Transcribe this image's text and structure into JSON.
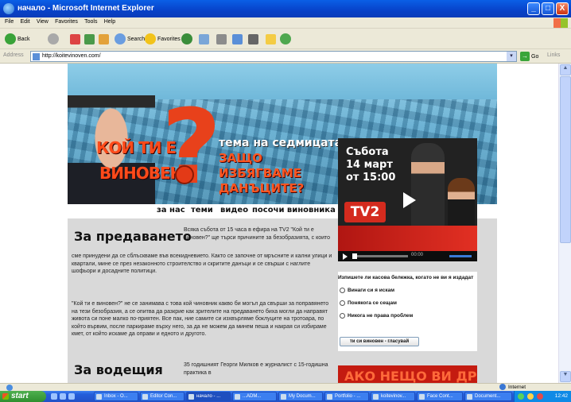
{
  "window": {
    "title": "начало - Microsoft Internet Explorer",
    "buttons": [
      "_",
      "□",
      "X"
    ]
  },
  "menu": [
    "File",
    "Edit",
    "View",
    "Favorites",
    "Tools",
    "Help"
  ],
  "toolbar": {
    "back": "Back",
    "search": "Search",
    "favorites": "Favorites"
  },
  "address": {
    "label": "Address",
    "url": "http://koitevinoven.com/",
    "go": "Go",
    "links": "Links"
  },
  "hero": {
    "headline_1": "КОЙ ТИ Е",
    "headline_2": "ВИНОВЕН",
    "qmark": "?",
    "topic_label": "тема на седмицата:",
    "topic_text": "ЗАЩО ИЗБЯГВАМЕ ДАНЪЦИТЕ?"
  },
  "nav": [
    "за нас",
    "теми",
    "видео",
    "посочи виновника"
  ],
  "promo": {
    "line1": "Събота",
    "line2": "14 март",
    "line3": "от 15:00",
    "channel": "TV2",
    "time": "00:00"
  },
  "poll": {
    "question": "Изпишете ли касова бележка, когато не ви я издадат",
    "options": [
      "Винаги си я искам",
      "Понякога се сещам",
      "Никога не права проблем"
    ],
    "vote": "ти си виновен - гласувай"
  },
  "ad": "АКО НЕЩО ВИ ДРАЗНИ",
  "articles": [
    {
      "title": "За предаването",
      "intro": "Всяка събота от 15 часа в ефира на TV2 \"Кой ти е виновен?\" ще търси причините за безобразията, с които",
      "p1": "сме принудени да се сблъскваме във всекидневието. Както се започне от мръсните и кални улици и квартали, мине се през незаконното строителство и скритите данъци и се свърши с наглите шофьори и досадните политици.",
      "p2": "\"Кой ти е виновен?\" не се занимава с това кой чиновник какво би могъл да свърши за поправянето на тези безобразия, а се опитва да разкрие как зрителите на предаването биха могли да направят живота си поне малко по-приятен. Все пак, ние самите си изхвърляме боклуците на тротоара, по който вървим, после паркираме върху него, за да не можем да минем пеша и накрая си избираме кмет, от който искаме да оправи и едното и другото."
    },
    {
      "title": "За водещия",
      "intro": "35 годишният Георги Милков е журналист с 15-годишна практика в"
    }
  ],
  "status": {
    "zone": "Internet"
  },
  "taskbar": {
    "start": "start",
    "tasks": [
      "Inbox - O...",
      "Editor Con...",
      "начало - ...",
      "...ADM...",
      "My Docum...",
      "Portfolio - ...",
      "koitevinov...",
      "Face Cont...",
      "Document..."
    ],
    "clock": "12:42"
  }
}
